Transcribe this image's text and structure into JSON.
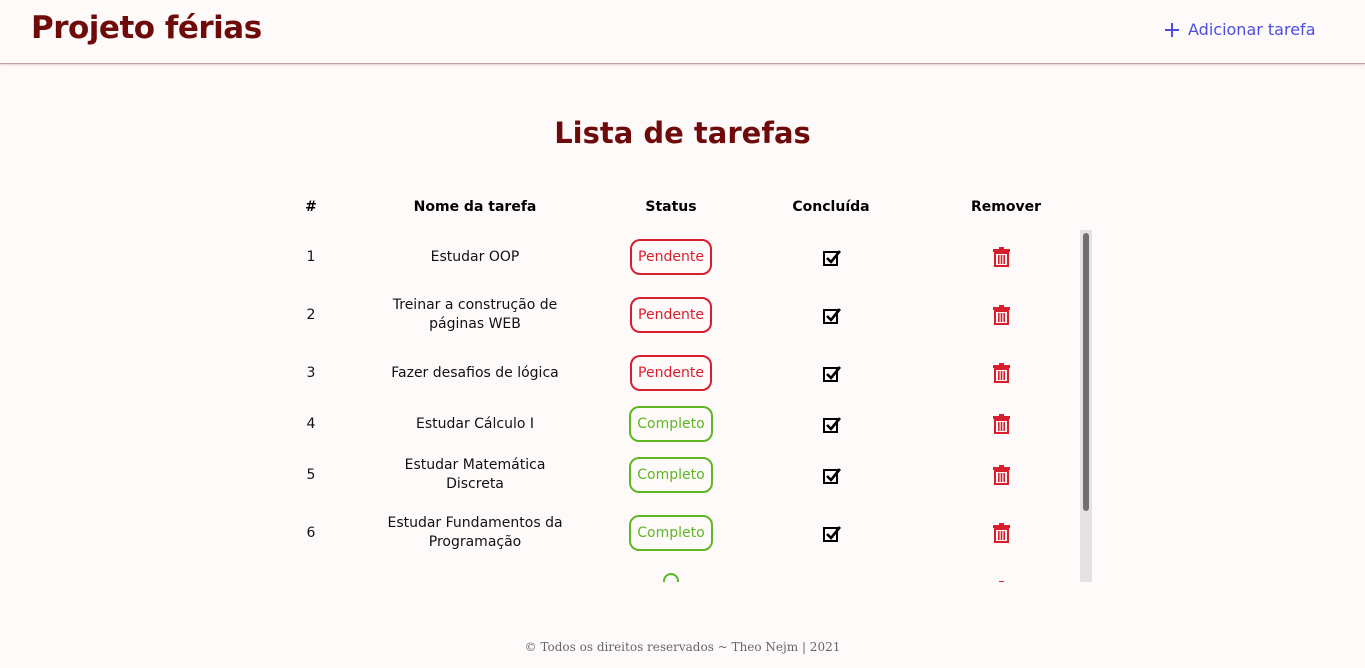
{
  "header": {
    "brand": "Projeto férias",
    "add_label": "Adicionar tarefa"
  },
  "page": {
    "title": "Lista de tarefas"
  },
  "table": {
    "columns": [
      "#",
      "Nome da tarefa",
      "Status",
      "Concluída",
      "Remover"
    ],
    "rows": [
      {
        "num": "1",
        "name": "Estudar OOP",
        "status": "Pendente",
        "state": "pending"
      },
      {
        "num": "2",
        "name": "Treinar a construção de páginas WEB",
        "status": "Pendente",
        "state": "pending"
      },
      {
        "num": "3",
        "name": "Fazer desafios de lógica",
        "status": "Pendente",
        "state": "pending"
      },
      {
        "num": "4",
        "name": "Estudar Cálculo I",
        "status": "Completo",
        "state": "complete"
      },
      {
        "num": "5",
        "name": "Estudar Matemática Discreta",
        "status": "Completo",
        "state": "complete"
      },
      {
        "num": "6",
        "name": "Estudar Fundamentos da Programação",
        "status": "Completo",
        "state": "complete"
      },
      {
        "num": "",
        "name": "",
        "status": "",
        "state": "complete"
      }
    ]
  },
  "icons": {
    "add": "plus-icon",
    "done": "checkbox-check-icon",
    "remove": "trash-icon"
  },
  "colors": {
    "brand": "#6e0a0a",
    "accent": "#4b4fe0",
    "pending": "#d81e2c",
    "complete": "#5db622",
    "trash": "#d81e2c"
  },
  "footer": {
    "text": "© Todos os direitos reservados ~ Theo Nejm | 2021"
  }
}
